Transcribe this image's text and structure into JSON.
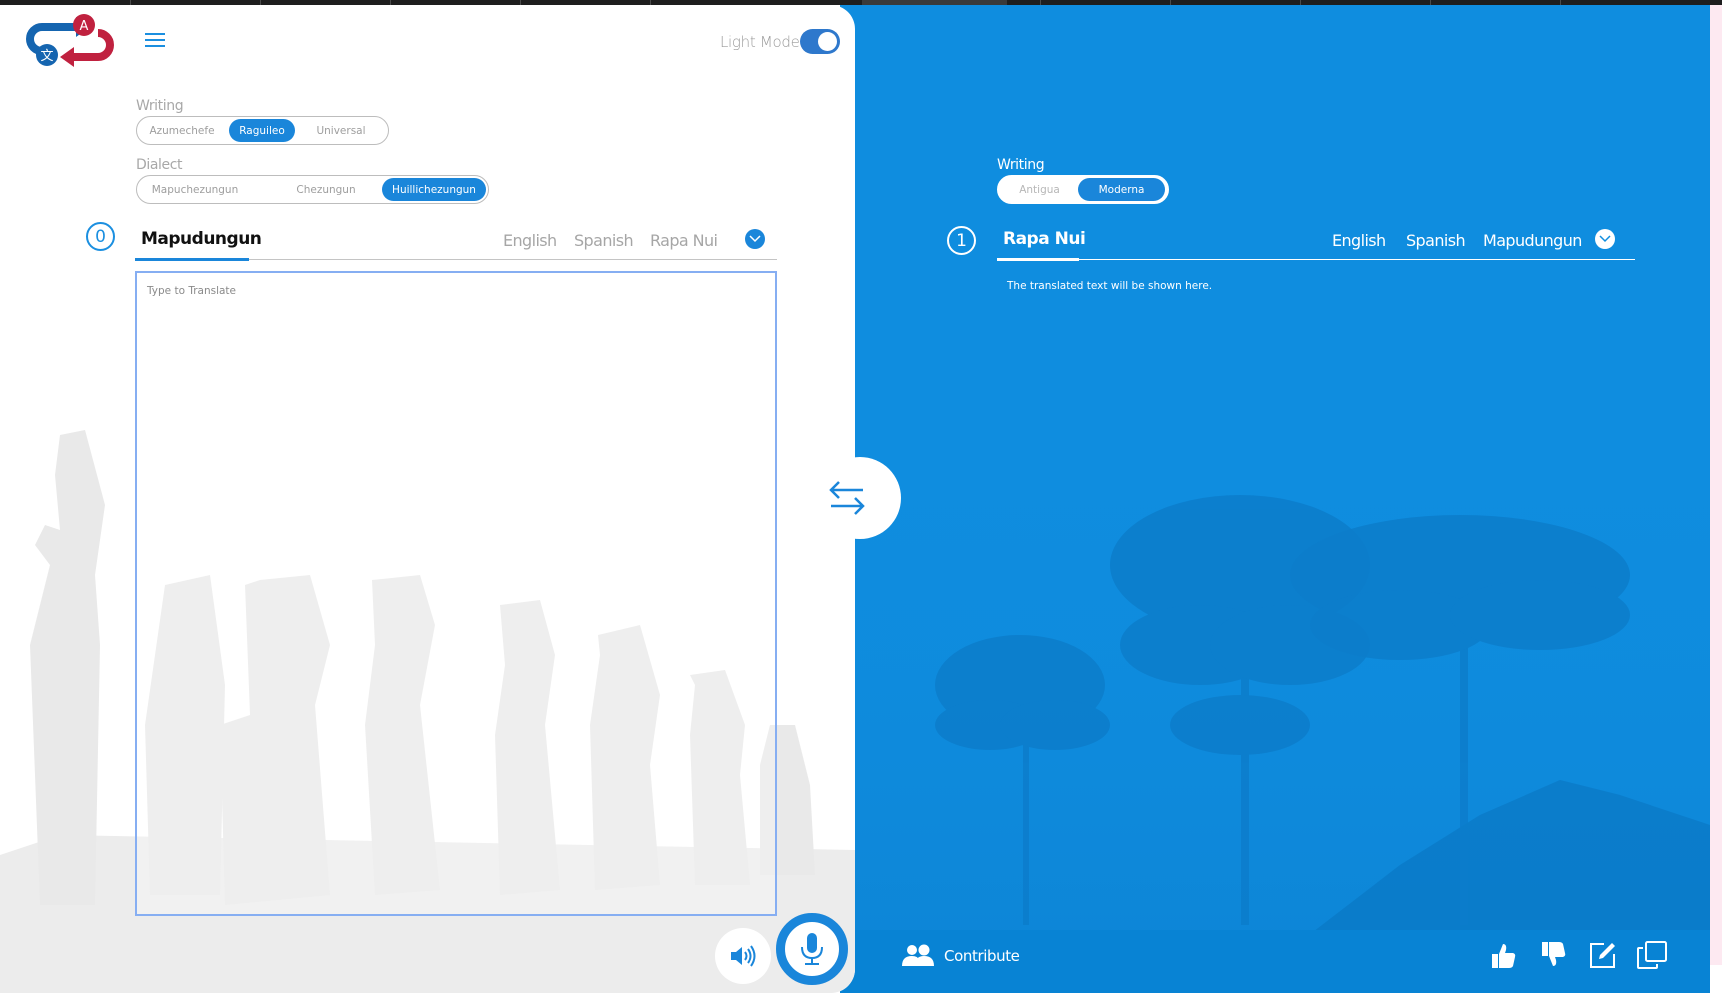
{
  "header": {
    "logo_alt": "translator-logo",
    "menu_icon": "hamburger-icon",
    "mode_label": "Light Mode",
    "mode_toggle_on": true
  },
  "source": {
    "writing": {
      "label": "Writing",
      "options": [
        "Azumechefe",
        "Raguileo",
        "Universal"
      ],
      "selected": "Raguileo"
    },
    "dialect": {
      "label": "Dialect",
      "options": [
        "Mapuchezungun",
        "Chezungun",
        "Huillichezungun"
      ],
      "selected": "Huillichezungun"
    },
    "index_number": "0",
    "active_language": "Mapudungun",
    "other_languages": [
      "English",
      "Spanish",
      "Rapa Nui"
    ],
    "dropdown_icon": "chevron-down-icon",
    "input": {
      "value": "",
      "placeholder": "Type to Translate"
    },
    "speaker_icon": "speaker-icon",
    "mic_icon": "microphone-icon"
  },
  "swap": {
    "icon": "swap-arrows-icon"
  },
  "target": {
    "writing": {
      "label": "Writing",
      "options": [
        "Antigua",
        "Moderna"
      ],
      "selected": "Moderna"
    },
    "index_number": "1",
    "active_language": "Rapa Nui",
    "other_languages": [
      "English",
      "Spanish",
      "Mapudungun"
    ],
    "dropdown_icon": "chevron-down-icon",
    "output_placeholder": "The translated text will be shown here.",
    "contribute_label": "Contribute",
    "actions": [
      "thumbs-up-icon",
      "thumbs-down-icon",
      "edit-icon",
      "copy-icon"
    ]
  },
  "colors": {
    "brand_blue": "#1a86da",
    "panel_blue": "#0f8ddf",
    "logo_red": "#c0213f",
    "logo_blue": "#1565b0",
    "textarea_border": "#86aef2"
  }
}
